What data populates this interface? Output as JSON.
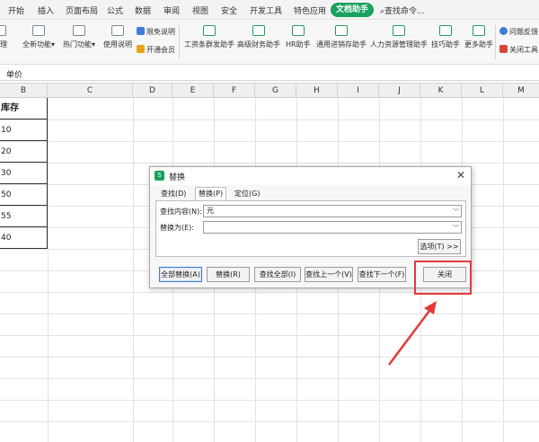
{
  "menubar": {
    "items": [
      "开始",
      "插入",
      "页面布局",
      "公式",
      "数据",
      "审阅",
      "视图",
      "安全",
      "开发工具",
      "特色应用"
    ],
    "active_tab": "文档助手",
    "search_label": "查找命令..."
  },
  "ribbon": {
    "left_partial": "处理",
    "buttons": [
      "全新功能",
      "热门功能",
      "使用说明",
      "工资条群发助手",
      "高级财务助手",
      "HR助手",
      "通用进销存助手",
      "人力资源管理助手",
      "技巧助手",
      "更多助手"
    ],
    "small_buttons": [
      "限免说明",
      "开通会员",
      "问题反馈",
      "关闭工具"
    ]
  },
  "formula_bar": {
    "content": "单价"
  },
  "columns": [
    "B",
    "C",
    "D",
    "E",
    "F",
    "G",
    "H",
    "I",
    "J",
    "K",
    "L",
    "M"
  ],
  "data_column": {
    "header": "库存",
    "values": [
      "10",
      "20",
      "30",
      "50",
      "55",
      "40"
    ]
  },
  "dialog": {
    "title": "替换",
    "logo": "S",
    "tabs": [
      "查找(D)",
      "替换(P)",
      "定位(G)"
    ],
    "active_tab_index": 1,
    "find_label": "查找内容(N):",
    "find_value": "元",
    "replace_label": "替换为(E):",
    "replace_value": "",
    "options_button": "选项(T) >>",
    "buttons": [
      "全部替换(A)",
      "替换(R)",
      "查找全部(I)",
      "查找上一个(V)",
      "查找下一个(F)"
    ],
    "close_button": "关闭"
  },
  "colors": {
    "accent": "#19a15f",
    "highlight": "#e53a3a"
  }
}
